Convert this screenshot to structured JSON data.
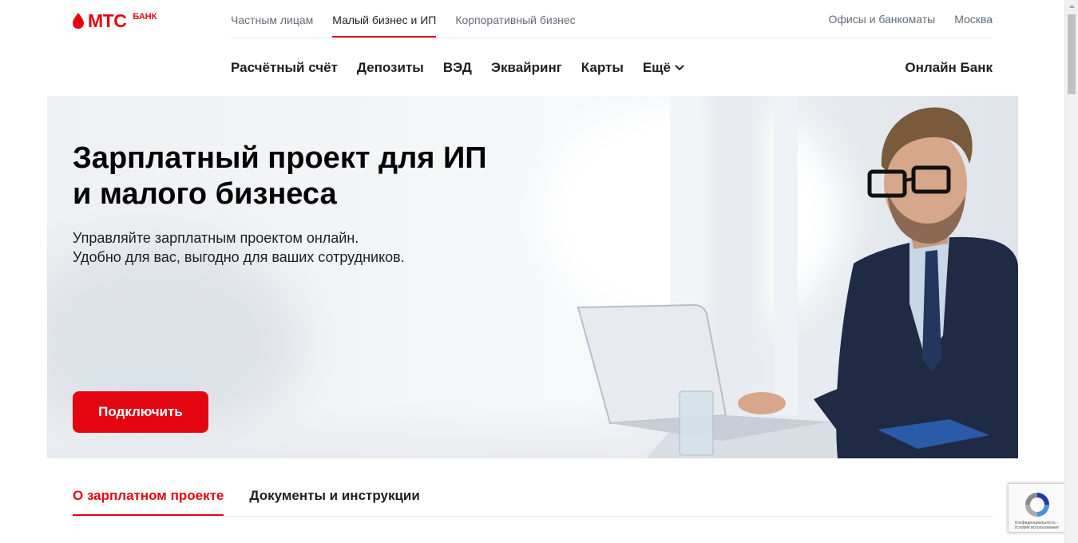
{
  "logo": {
    "mts": "МТС",
    "bank": "БАНК"
  },
  "top_nav": [
    {
      "label": "Частным лицам",
      "active": false
    },
    {
      "label": "Малый бизнес и ИП",
      "active": true
    },
    {
      "label": "Корпоративный бизнес",
      "active": false
    }
  ],
  "top_right": {
    "offices": "Офисы и банкоматы",
    "city": "Москва"
  },
  "main_nav": {
    "items": [
      "Расчётный счёт",
      "Депозиты",
      "ВЭД",
      "Эквайринг",
      "Карты"
    ],
    "more": "Ещё",
    "online_bank": "Онлайн Банк"
  },
  "hero": {
    "title_line1": "Зарплатный проект для ИП",
    "title_line2": "и малого бизнеса",
    "subtitle_line1": "Управляйте зарплатным проектом онлайн.",
    "subtitle_line2": "Удобно для вас, выгодно для ваших сотрудников.",
    "cta": "Подключить"
  },
  "tabs": [
    {
      "label": "О зарплатном проекте",
      "active": true
    },
    {
      "label": "Документы и инструкции",
      "active": false
    }
  ],
  "recaptcha": {
    "text": "Конфиденциальность - Условия использования"
  },
  "colors": {
    "brand_red": "#e30611",
    "text": "#1d2023",
    "muted": "#626c77"
  }
}
